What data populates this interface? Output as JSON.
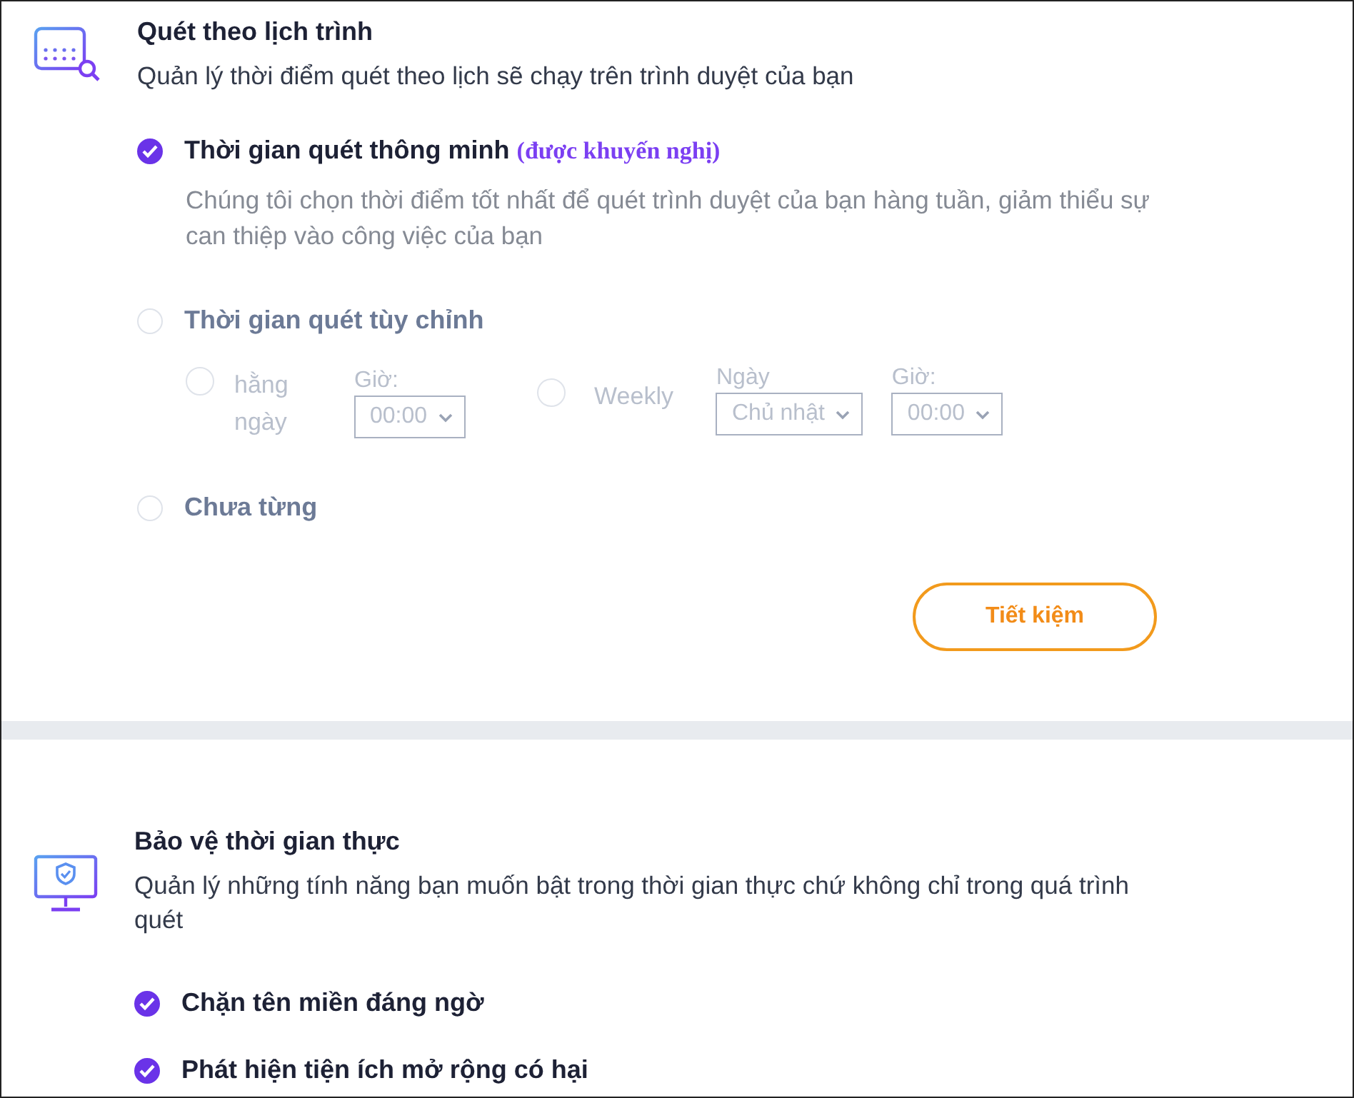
{
  "schedule": {
    "title": "Quét theo lịch trình",
    "description": "Quản lý thời điểm quét theo lịch sẽ chạy trên trình duyệt của bạn",
    "options": [
      {
        "kind": "smart",
        "label": "Thời gian quét thông minh",
        "tag": "(được khuyến nghị)",
        "note": "Chúng tôi chọn thời điểm tốt nhất để quét trình duyệt của bạn hàng tuần, giảm thiểu sự can thiệp vào công việc của bạn",
        "selected": true
      },
      {
        "kind": "custom",
        "label": "Thời gian quét tùy chỉnh",
        "selected": false,
        "frequencies": [
          {
            "label": "hằng ngày",
            "selected": false,
            "fields": [
              {
                "label": "Giờ:",
                "value": "00:00"
              }
            ]
          },
          {
            "label": "Weekly",
            "selected": false,
            "fields": [
              {
                "label": "Ngày",
                "value": "Chủ nhật"
              },
              {
                "label": "Giờ:",
                "value": "00:00"
              }
            ]
          }
        ]
      },
      {
        "kind": "never",
        "label": "Chưa từng",
        "selected": false
      }
    ],
    "save_button": "Tiết kiệm"
  },
  "realtime": {
    "title": "Bảo vệ thời gian thực",
    "description": "Quản lý những tính năng bạn muốn bật trong thời gian thực chứ không chỉ trong quá trình quét",
    "items": [
      {
        "label": "Chặn tên miền đáng ngờ",
        "checked": true
      },
      {
        "label": "Phát hiện tiện ích mở rộng có hại",
        "checked": true
      }
    ]
  }
}
